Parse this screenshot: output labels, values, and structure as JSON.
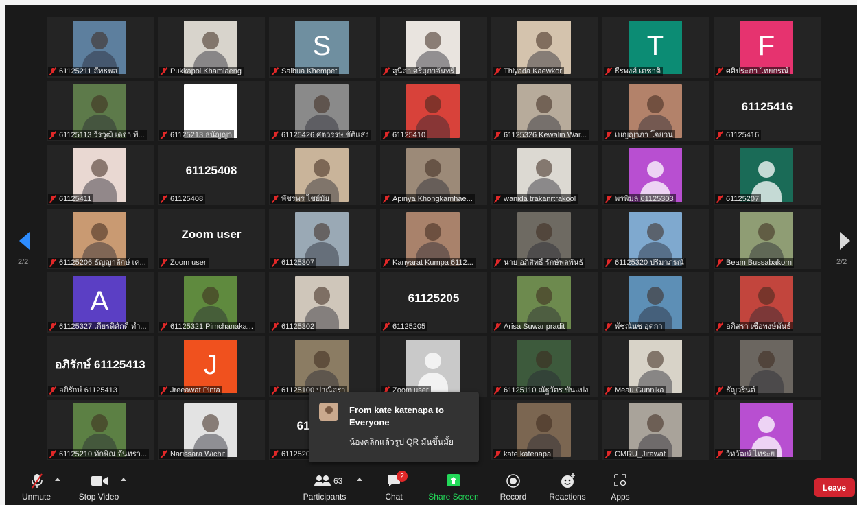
{
  "navigation": {
    "page_indicator": "2/2"
  },
  "participants": [
    {
      "name": "61125211 ลัทธพล",
      "kind": "photo",
      "bg": "#5d7f9e"
    },
    {
      "name": "Pukkapol Khamlaeng",
      "kind": "photo",
      "bg": "#d8d4cc"
    },
    {
      "name": "Saibua Khempet",
      "kind": "letter",
      "letter": "S",
      "bg": "#6f8fa0"
    },
    {
      "name": "สุนิสา ศรีสุภาจันทร์",
      "kind": "photo",
      "bg": "#e9e4df"
    },
    {
      "name": "Thiyada Kaewkor",
      "kind": "photo",
      "bg": "#d4c3ad"
    },
    {
      "name": "ธีรพงศ์ เดชาติ",
      "kind": "letter",
      "letter": "T",
      "bg": "#0c8c74"
    },
    {
      "name": "ศศิประภา ไทยกรณ์",
      "kind": "letter",
      "letter": "F",
      "bg": "#e6336f"
    },
    {
      "name": "61125113 วีรวุฒิ เดจา พี...",
      "kind": "photo",
      "bg": "#5d7a4a"
    },
    {
      "name": "61125213 ธนัญญา",
      "kind": "blank",
      "bg": "#ffffff"
    },
    {
      "name": "61125426 ศตวรรษ ขัติแสง",
      "kind": "photo",
      "bg": "#8a8a8a"
    },
    {
      "name": "61125410",
      "kind": "photo",
      "bg": "#d8423a"
    },
    {
      "name": "61125326 Kewalin War...",
      "kind": "photo",
      "bg": "#b7ab9b"
    },
    {
      "name": "เบญญาภา โจยวน",
      "kind": "photo",
      "bg": "#b3826a"
    },
    {
      "name": "61125416",
      "kind": "text",
      "big": "61125416"
    },
    {
      "name": "61125411",
      "kind": "photo",
      "bg": "#e9d8d2"
    },
    {
      "name": "61125408",
      "kind": "text",
      "big": "61125408"
    },
    {
      "name": "พัชรพร ไชย์มัย",
      "kind": "photo",
      "bg": "#c9b49a"
    },
    {
      "name": "Apinya Khongkamhae...",
      "kind": "photo",
      "bg": "#9c8a78"
    },
    {
      "name": "wanida trakanrtrakool",
      "kind": "photo",
      "bg": "#dcd9d2"
    },
    {
      "name": "พรพิมล 61125303",
      "kind": "avatar",
      "bg": "#b84fd1"
    },
    {
      "name": "61125207",
      "kind": "avatar",
      "bg": "#1a6b57"
    },
    {
      "name": "61125206 ธัญญาลักษ์ เค...",
      "kind": "photo",
      "bg": "#c99a72"
    },
    {
      "name": "Zoom user",
      "kind": "text",
      "big": "Zoom user"
    },
    {
      "name": "61125307",
      "kind": "photo",
      "bg": "#9aa9b5"
    },
    {
      "name": "Kanyarat Kumpa 6112...",
      "kind": "photo",
      "bg": "#a9826b"
    },
    {
      "name": "นาย อภิสิทธิ์ รักษ์พลพันธ์",
      "kind": "photo",
      "bg": "#6e6a62"
    },
    {
      "name": "61125320 ปริมาภรณ์",
      "kind": "photo",
      "bg": "#7fa9cf"
    },
    {
      "name": "Beam Bussabakorn",
      "kind": "photo",
      "bg": "#8f9d74"
    },
    {
      "name": "61125327 เกียรติศักดิ์ ทำ...",
      "kind": "letter",
      "letter": "A",
      "bg": "#5b3fc4"
    },
    {
      "name": "61125321 Pimchanaka...",
      "kind": "photo",
      "bg": "#5f8a3e"
    },
    {
      "name": "61125302",
      "kind": "photo",
      "bg": "#cfc6ba"
    },
    {
      "name": "61125205",
      "kind": "text",
      "big": "61125205"
    },
    {
      "name": "Arisa Suwanpradit",
      "kind": "photo",
      "bg": "#6d8a4e"
    },
    {
      "name": "พัชณันช อุดกา",
      "kind": "photo",
      "bg": "#5d8fb6"
    },
    {
      "name": "อภิสรา เชื้อพงษ์พันธ์",
      "kind": "photo",
      "bg": "#c2453d"
    },
    {
      "name": "อภิรักษ์ 61125413",
      "kind": "text",
      "big": "อภิรักษ์ 61125413"
    },
    {
      "name": "Jreeawat Pinta",
      "kind": "letter",
      "letter": "J",
      "bg": "#f0511e"
    },
    {
      "name": "61125100 ปาณิสรา",
      "kind": "photo",
      "bg": "#8b7c63"
    },
    {
      "name": "Zoom user",
      "kind": "avatar-grey",
      "bg": "#c9c9c9"
    },
    {
      "name": "61125110 ณัฐวัตร ขันแปง",
      "kind": "photo",
      "bg": "#3d5a3c"
    },
    {
      "name": "Meau Gunnika",
      "kind": "photo",
      "bg": "#d8d3c8"
    },
    {
      "name": "ธัญวรินต์",
      "kind": "photo",
      "bg": "#6b6660"
    },
    {
      "name": "61125210 ทักษิณ จันทรา...",
      "kind": "photo",
      "bg": "#5c8044"
    },
    {
      "name": "Narissara Wichit",
      "kind": "photo",
      "bg": "#e3e3e3"
    },
    {
      "name": "61125201",
      "kind": "text",
      "big": "61125201"
    },
    {
      "name": "",
      "kind": "hidden"
    },
    {
      "name": "kate katenapa",
      "kind": "photo",
      "bg": "#7b6651"
    },
    {
      "name": "CMRU_Jirawat",
      "kind": "photo",
      "bg": "#a9a39a"
    },
    {
      "name": "วิทวัฒน์ ไทระย",
      "kind": "avatar",
      "bg": "#b84fd1"
    }
  ],
  "chat_toast": {
    "from": "From kate katenapa to Everyone",
    "message": "น้องคลิกแล้วรูป QR มันขึ้นมั้ย"
  },
  "toolbar": {
    "unmute": "Unmute",
    "stop_video": "Stop Video",
    "participants": "Participants",
    "participants_count": "63",
    "chat": "Chat",
    "chat_badge": "2",
    "share_screen": "Share Screen",
    "record": "Record",
    "reactions": "Reactions",
    "apps": "Apps",
    "leave": "Leave"
  },
  "colors": {
    "background": "#1a1a1a",
    "tile": "#242424",
    "accent_blue": "#2d8cff",
    "share_green": "#23d959",
    "leave_red": "#d1242f",
    "muted_red": "#e02828"
  }
}
